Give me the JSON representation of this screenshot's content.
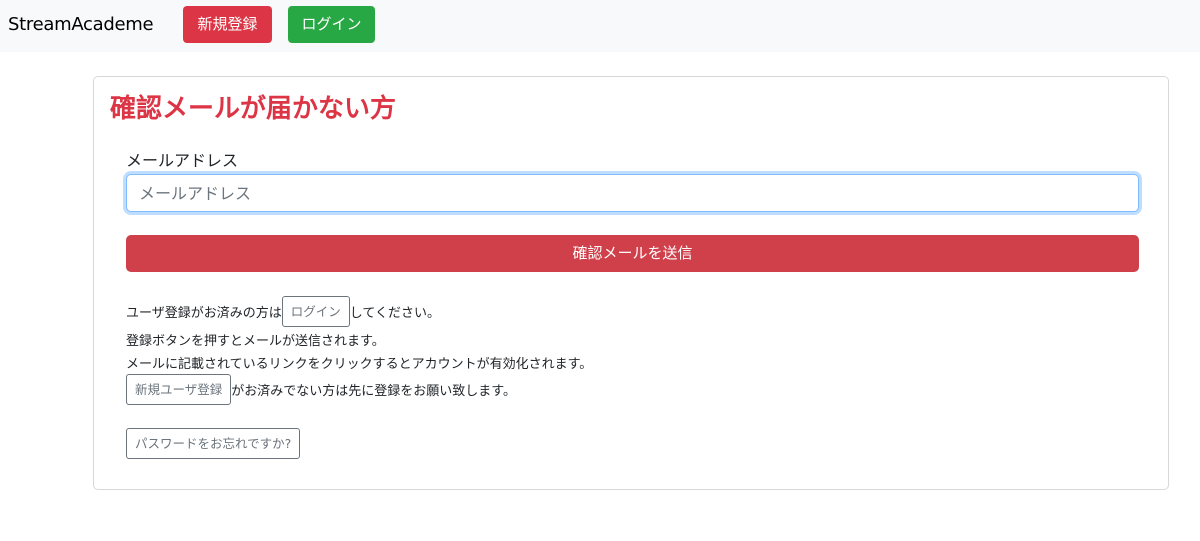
{
  "navbar": {
    "brand": "StreamAcademe",
    "register_label": "新規登録",
    "login_label": "ログイン",
    "register_color": "#dc3545",
    "login_color": "#28a745"
  },
  "card": {
    "title": "確認メールが届かない方",
    "email_label": "メールアドレス",
    "email_placeholder": "メールアドレス",
    "email_value": "",
    "submit_label": "確認メールを送信",
    "accent_color": "#dc3545",
    "info": {
      "line1_before": "ユーザ登録がお済みの方は",
      "line1_button": "ログイン",
      "line1_after": "してください。",
      "line2": "登録ボタンを押すとメールが送信されます。",
      "line3": "メールに記載されているリンクをクリックするとアカウントが有効化されます。",
      "line4_button": "新規ユーザ登録",
      "line4_after": "がお済みでない方は先に登録をお願い致します。"
    },
    "forgot_label": "パスワードをお忘れですか?"
  }
}
